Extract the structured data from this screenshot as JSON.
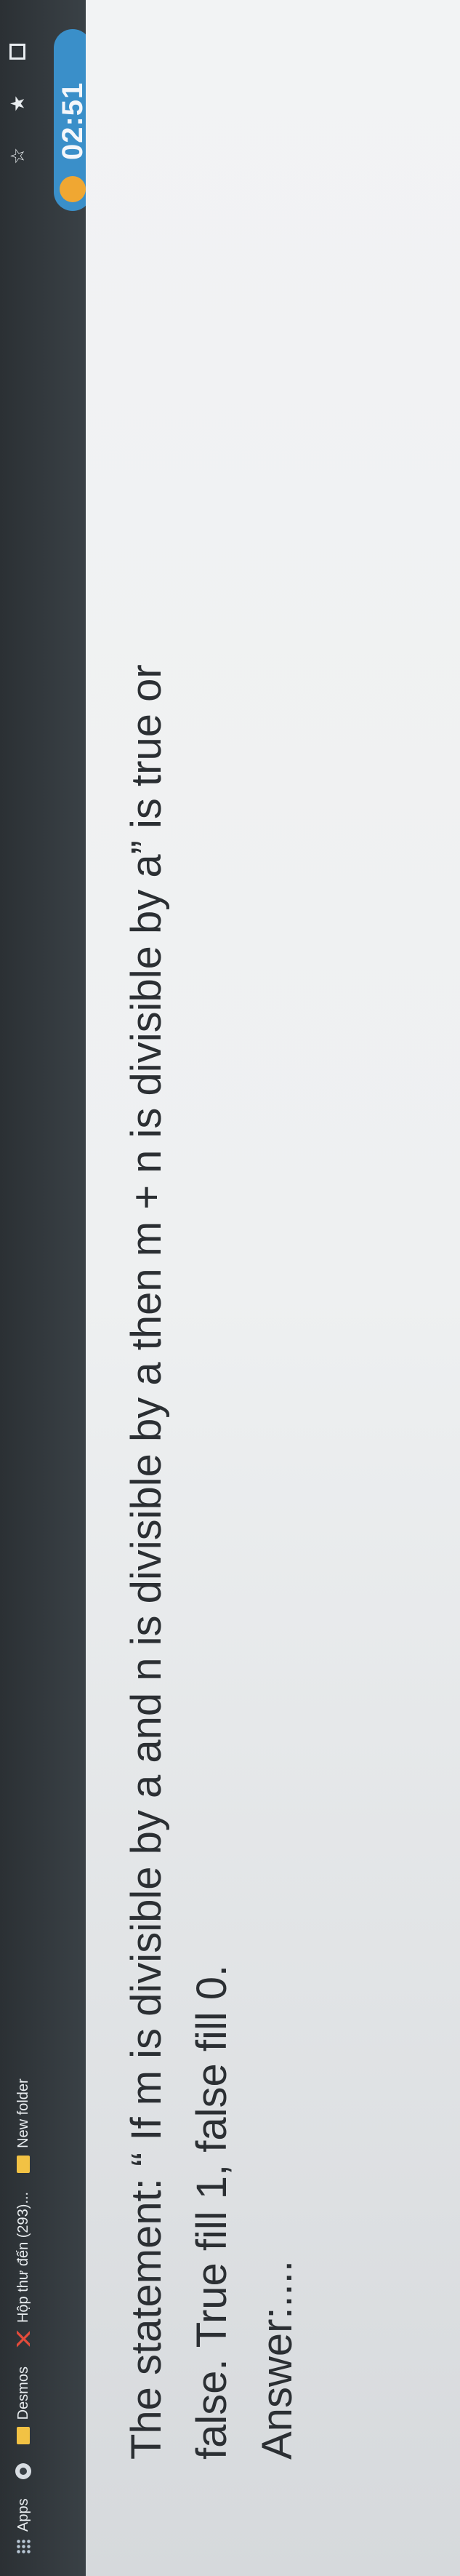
{
  "bookmarks": [
    {
      "label": "Apps",
      "icon": "apps-grid-icon"
    },
    {
      "label": "",
      "icon": "google-g-icon"
    },
    {
      "label": "Desmos",
      "icon": "folder-icon"
    },
    {
      "label": "Hộp thư đến (293)...",
      "icon": "gmail-icon"
    },
    {
      "label": "New folder",
      "icon": "folder-icon"
    }
  ],
  "timer": "02:51",
  "question": {
    "line1": "The statement: “ If m is divisible by a and n is divisible by a then m + n is divisible by a” is true or",
    "line2": "false. True fill 1, false fill 0.",
    "answer": "Answer:...."
  }
}
